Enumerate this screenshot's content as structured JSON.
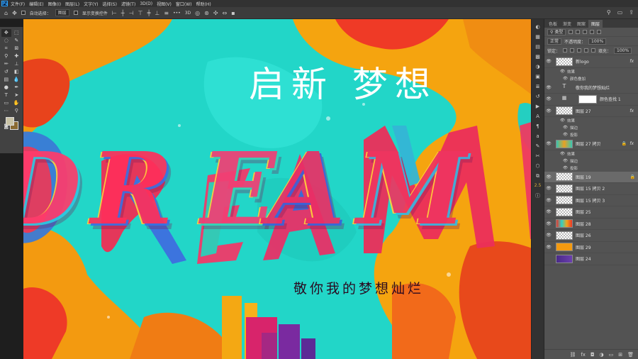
{
  "app": {
    "logo": "Ps",
    "menu": [
      "文件(F)",
      "编辑(E)",
      "图像(I)",
      "图层(L)",
      "文字(Y)",
      "选择(S)",
      "滤镜(T)",
      "3D(D)",
      "视图(V)",
      "窗口(W)",
      "帮助(H)"
    ]
  },
  "options_bar": {
    "auto_select_label": "自动选择：",
    "auto_select_value": "图层",
    "show_transform_label": "显示变换控件",
    "more": "•••"
  },
  "canvas": {
    "title": "启新 梦想",
    "word": "DREAM",
    "subtitle": "敬你我的梦想灿烂"
  },
  "mid_strip": {
    "badge": "2.5"
  },
  "panel": {
    "tabs": [
      "色板",
      "渐变",
      "图案",
      "图层"
    ],
    "filter_type": "类型",
    "blend_mode": "正常",
    "opacity_label": "不透明度：",
    "opacity_value": "100%",
    "lock_label": "锁定：",
    "fill_label": "填充：",
    "fill_value": "100%",
    "layers": [
      {
        "name": "新logo",
        "fx": true
      },
      {
        "name": "敬你我的梦想灿烂",
        "type": "text"
      },
      {
        "name": "颜色查找 1",
        "type": "adjust"
      },
      {
        "name": "图层 27",
        "fx": true
      },
      {
        "name": "图层 27 拷贝",
        "fx": true
      },
      {
        "name": "图层 19",
        "selected": true
      },
      {
        "name": "图层 15 拷贝 2"
      },
      {
        "name": "图层 15 拷贝 3"
      },
      {
        "name": "图层 25"
      },
      {
        "name": "图层 28"
      },
      {
        "name": "图层 26"
      },
      {
        "name": "图层 29"
      },
      {
        "name": "图层 24",
        "hidden": true
      }
    ],
    "sub_effects": "效果",
    "sub_color_overlay": "颜色叠加",
    "sub_stroke": "描边",
    "sub_shadow": "投影"
  }
}
